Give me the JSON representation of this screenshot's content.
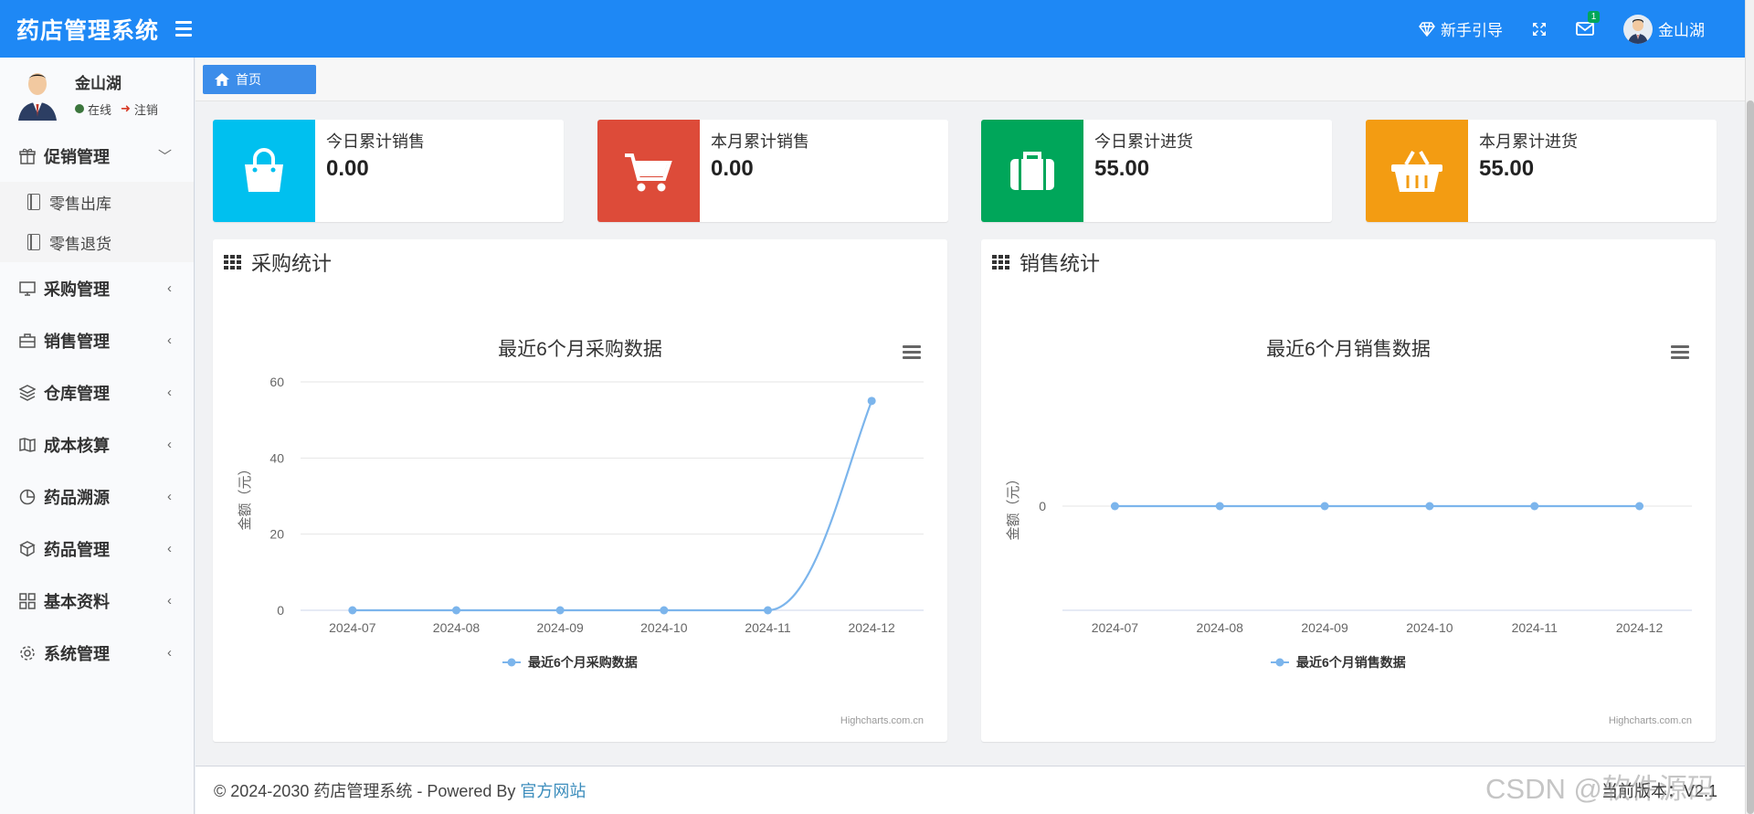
{
  "app": {
    "title": "药店管理系统"
  },
  "header": {
    "guide_label": "新手引导",
    "mail_badge": "1",
    "user_name": "金山湖"
  },
  "sidebar": {
    "user": {
      "name": "金山湖",
      "status_online": "在线",
      "logout": "注销"
    },
    "menu": [
      {
        "label": "促销管理",
        "icon": "gift-icon",
        "expanded": true,
        "children": [
          {
            "label": "零售出库"
          },
          {
            "label": "零售退货"
          }
        ]
      },
      {
        "label": "采购管理",
        "icon": "desktop-icon"
      },
      {
        "label": "销售管理",
        "icon": "briefcase-icon"
      },
      {
        "label": "仓库管理",
        "icon": "layers-icon"
      },
      {
        "label": "成本核算",
        "icon": "map-icon"
      },
      {
        "label": "药品溯源",
        "icon": "pie-chart-icon"
      },
      {
        "label": "药品管理",
        "icon": "cubes-icon"
      },
      {
        "label": "基本资料",
        "icon": "grid-icon"
      },
      {
        "label": "系统管理",
        "icon": "gear-icon"
      }
    ]
  },
  "tabs": [
    {
      "label": "首页",
      "icon": "home-icon"
    }
  ],
  "info_boxes": [
    {
      "label": "今日累计销售",
      "value": "0.00",
      "color": "#00c0ef",
      "icon": "shopping-bag-icon"
    },
    {
      "label": "本月累计销售",
      "value": "0.00",
      "color": "#dd4b39",
      "icon": "shopping-cart-icon"
    },
    {
      "label": "今日累计进货",
      "value": "55.00",
      "color": "#00a65a",
      "icon": "suitcase-icon"
    },
    {
      "label": "本月累计进货",
      "value": "55.00",
      "color": "#f39c12",
      "icon": "basket-icon"
    }
  ],
  "panels": {
    "purchase": {
      "title": "采购统计"
    },
    "sales": {
      "title": "销售统计"
    }
  },
  "chart_data": [
    {
      "type": "line",
      "title": "最近6个月采购数据",
      "ylabel": "金额（元）",
      "xlabel": "",
      "categories": [
        "2024-07",
        "2024-08",
        "2024-09",
        "2024-10",
        "2024-11",
        "2024-12"
      ],
      "series": [
        {
          "name": "最近6个月采购数据",
          "values": [
            0,
            0,
            0,
            0,
            0,
            55
          ]
        }
      ],
      "ylim": [
        0,
        60
      ],
      "yticks": [
        0,
        20,
        40,
        60
      ],
      "grid": true,
      "legend": "bottom-center",
      "credits": "Highcharts.com.cn",
      "color": "#7cb5ec"
    },
    {
      "type": "line",
      "title": "最近6个月销售数据",
      "ylabel": "金额（元）",
      "xlabel": "",
      "categories": [
        "2024-07",
        "2024-08",
        "2024-09",
        "2024-10",
        "2024-11",
        "2024-12"
      ],
      "series": [
        {
          "name": "最近6个月销售数据",
          "values": [
            0,
            0,
            0,
            0,
            0,
            0
          ]
        }
      ],
      "yticks": [
        0
      ],
      "grid": true,
      "legend": "bottom-center",
      "credits": "Highcharts.com.cn",
      "color": "#7cb5ec"
    }
  ],
  "footer": {
    "copyright": "© 2024-2030 药店管理系统 - Powered By",
    "link": "官方网站",
    "version": "当前版本：V2.1"
  },
  "watermark": "CSDN @软件源码"
}
